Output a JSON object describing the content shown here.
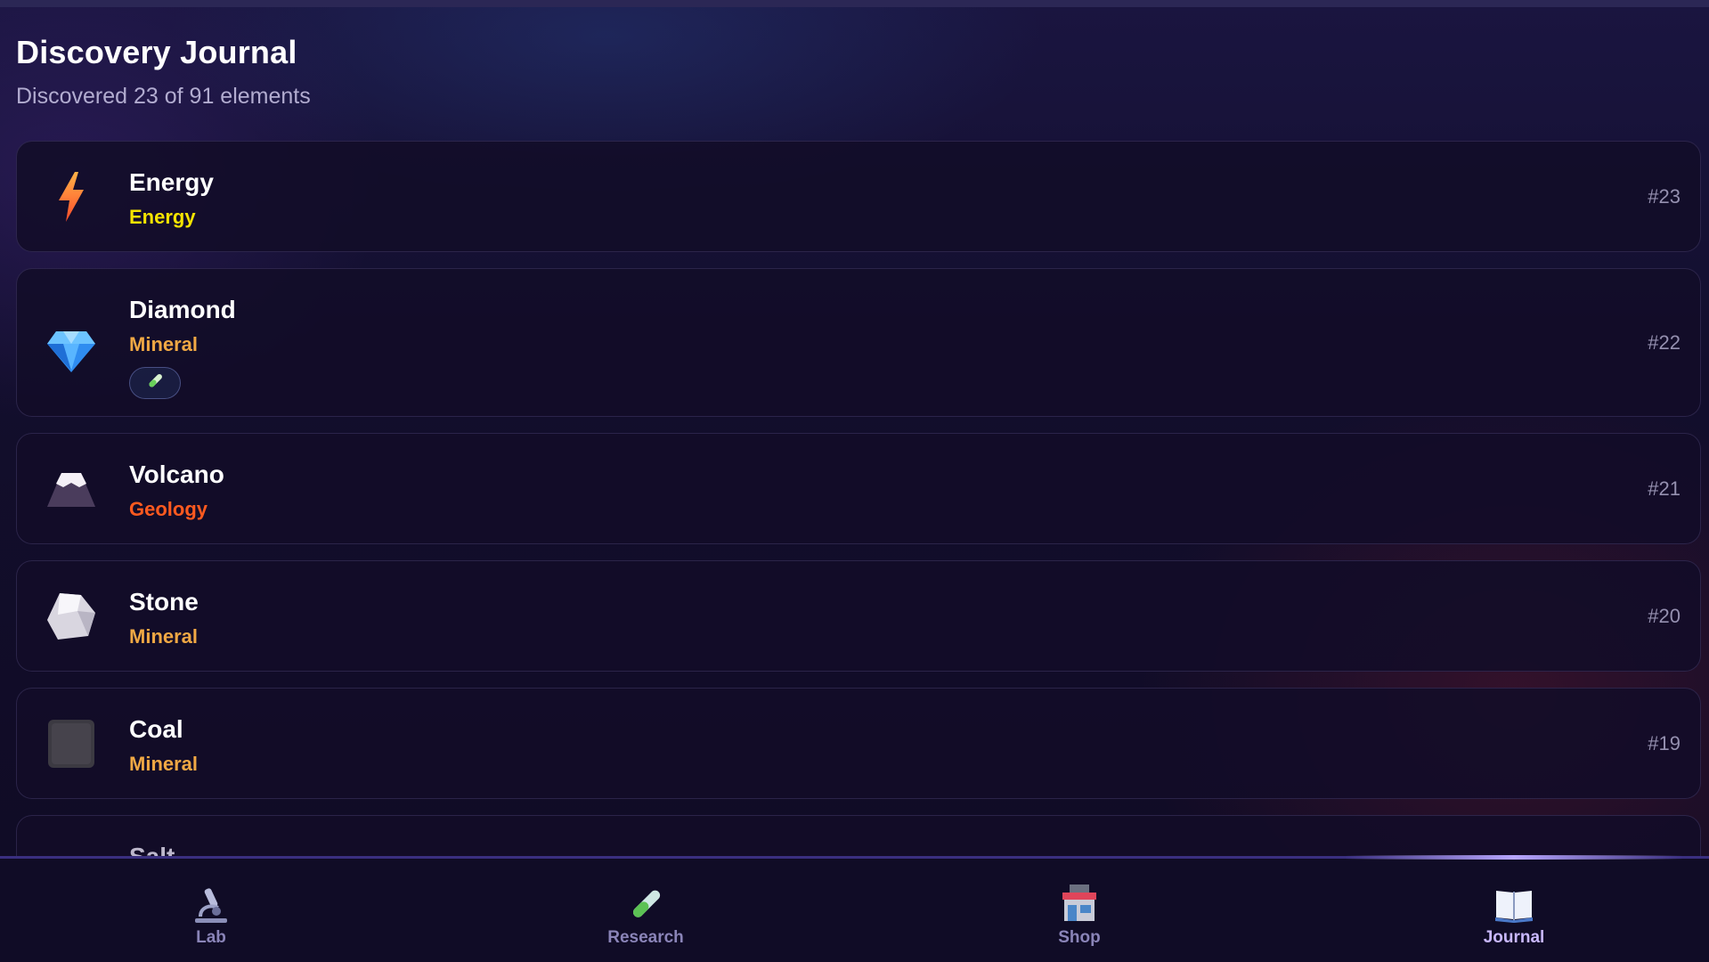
{
  "header": {
    "title": "Discovery Journal",
    "subtitle": "Discovered 23 of 91 elements"
  },
  "entries": [
    {
      "name": "Energy",
      "category": "Energy",
      "category_color": "#f5e400",
      "number": "#23",
      "icon": "lightning-icon"
    },
    {
      "name": "Diamond",
      "category": "Mineral",
      "category_color": "#f0a844",
      "number": "#22",
      "icon": "diamond-icon",
      "badge": "test-tube-icon"
    },
    {
      "name": "Volcano",
      "category": "Geology",
      "category_color": "#ff5a1f",
      "number": "#21",
      "icon": "volcano-icon"
    },
    {
      "name": "Stone",
      "category": "Mineral",
      "category_color": "#f0a844",
      "number": "#20",
      "icon": "stone-icon"
    },
    {
      "name": "Coal",
      "category": "Mineral",
      "category_color": "#f0a844",
      "number": "#19",
      "icon": "coal-icon"
    },
    {
      "name": "Salt",
      "icon": "salt-icon"
    }
  ],
  "nav": {
    "items": [
      {
        "label": "Lab",
        "icon": "microscope-icon"
      },
      {
        "label": "Research",
        "icon": "test-tube-icon"
      },
      {
        "label": "Shop",
        "icon": "shop-icon"
      },
      {
        "label": "Journal",
        "icon": "book-icon",
        "active": true
      }
    ]
  },
  "colors": {
    "background": "#100b24",
    "card": "#120d28",
    "accent": "#b7a6ff"
  }
}
